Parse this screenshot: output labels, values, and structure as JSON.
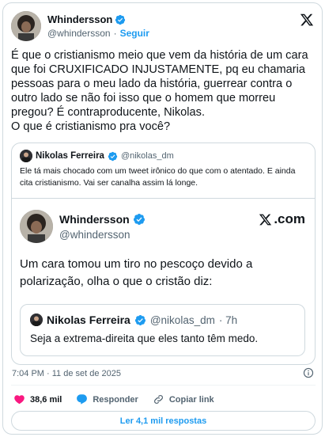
{
  "tweet": {
    "author_name": "Whindersson",
    "author_handle": "@whindersson",
    "separator": "·",
    "follow_label": "Seguir",
    "text": "É que o cristianismo meio que vem da história de um cara\nque foi CRUXIFICADO INJUSTAMENTE, pq eu chamaria\npessoas para o meu lado da história, guerrear contra o\noutro lado se não foi isso que o homem que morreu\npregou? É contraproducente, Nikolas.\nO que é cristianismo pra você?"
  },
  "quoted": {
    "author_name": "Nikolas Ferreira",
    "author_handle": "@nikolas_dm",
    "text": "Ele tá mais chocado com um tweet irônico do que com o atentado. E ainda cita cristianismo. Vai ser canalha assim lá longe."
  },
  "embed": {
    "author_name": "Whindersson",
    "author_handle": "@whindersson",
    "brand": ".com",
    "text": "Um cara tomou um tiro no pescoço devido a polarização, olha o que o cristão diz:",
    "inner_quote": {
      "author_name": "Nikolas Ferreira",
      "author_handle": "@nikolas_dm",
      "time": "· 7h",
      "text": "Seja a extrema-direita que eles tanto têm medo."
    }
  },
  "meta": {
    "timestamp": "7:04 PM · 11 de set de 2025"
  },
  "actions": {
    "likes": "38,6 mil",
    "reply_label": "Responder",
    "copy_label": "Copiar link",
    "read_replies_label": "Ler 4,1 mil respostas"
  },
  "colors": {
    "accent": "#1d9bf0",
    "like": "#f91880",
    "muted": "#536471",
    "border": "#cfd9de"
  },
  "icons": [
    "verified-badge-icon",
    "x-logo-icon",
    "info-icon",
    "heart-icon",
    "reply-bubble-icon",
    "link-icon"
  ]
}
